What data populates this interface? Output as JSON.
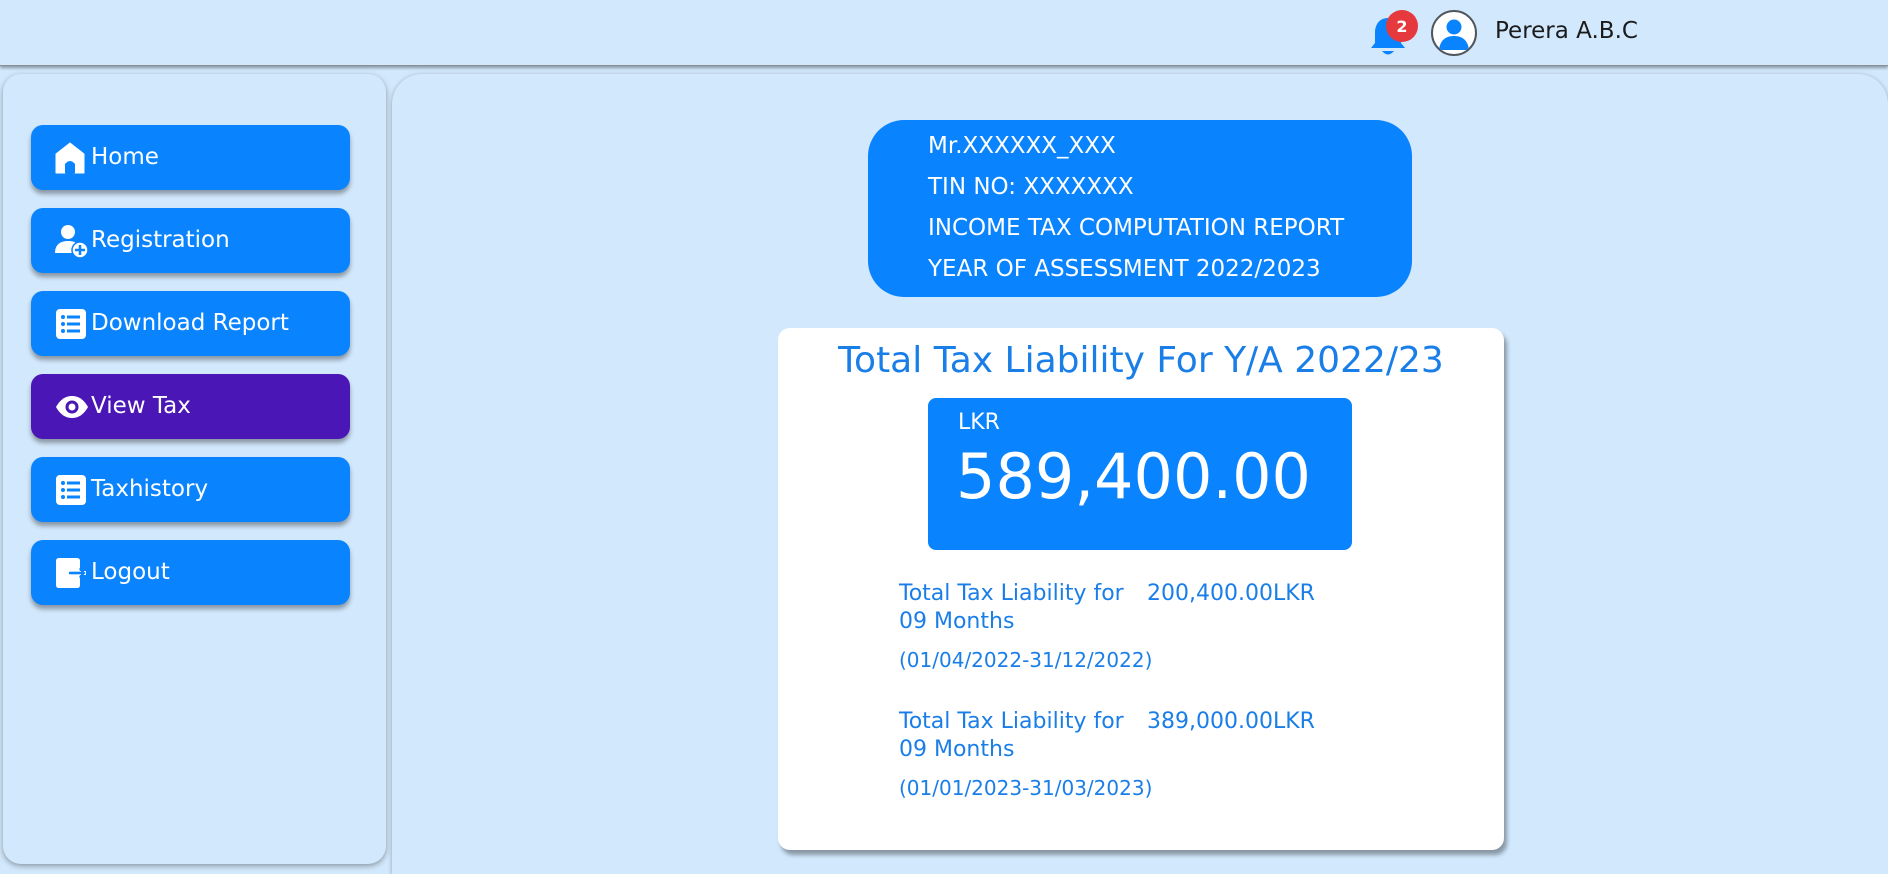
{
  "header": {
    "notification_count": "2",
    "user_name": "Perera A.B.C"
  },
  "sidebar": {
    "items": [
      {
        "label": "Home",
        "icon": "home-icon",
        "active": false
      },
      {
        "label": "Registration",
        "icon": "add-user-icon",
        "active": false
      },
      {
        "label": "Download Report",
        "icon": "list-icon",
        "active": false
      },
      {
        "label": "View Tax",
        "icon": "eye-icon",
        "active": true
      },
      {
        "label": "Taxhistory",
        "icon": "list-icon",
        "active": false
      },
      {
        "label": "Logout",
        "icon": "logout-icon",
        "active": false
      }
    ]
  },
  "report": {
    "name": "Mr.XXXXXX_XXX",
    "tin": "TIN NO: XXXXXXX",
    "title": "INCOME TAX COMPUTATION REPORT",
    "year": "YEAR OF ASSESSMENT 2022/2023"
  },
  "summary": {
    "title": "Total Tax Liability For Y/A 2022/23",
    "currency": "LKR",
    "total": "589,400.00",
    "periods": [
      {
        "label": "Total Tax Liability for 09 Months",
        "amount": "200,400.00LKR",
        "dates": "(01/04/2022-31/12/2022)"
      },
      {
        "label": "Total Tax Liability for 09 Months",
        "amount": "389,000.00LKR",
        "dates": "(01/01/2023-31/03/2023)"
      }
    ]
  },
  "colors": {
    "background": "#d2e8fc",
    "primary": "#0a84fe",
    "active": "#4a16b6",
    "badge": "#e5393e",
    "accent_text": "#1a7ee8"
  }
}
